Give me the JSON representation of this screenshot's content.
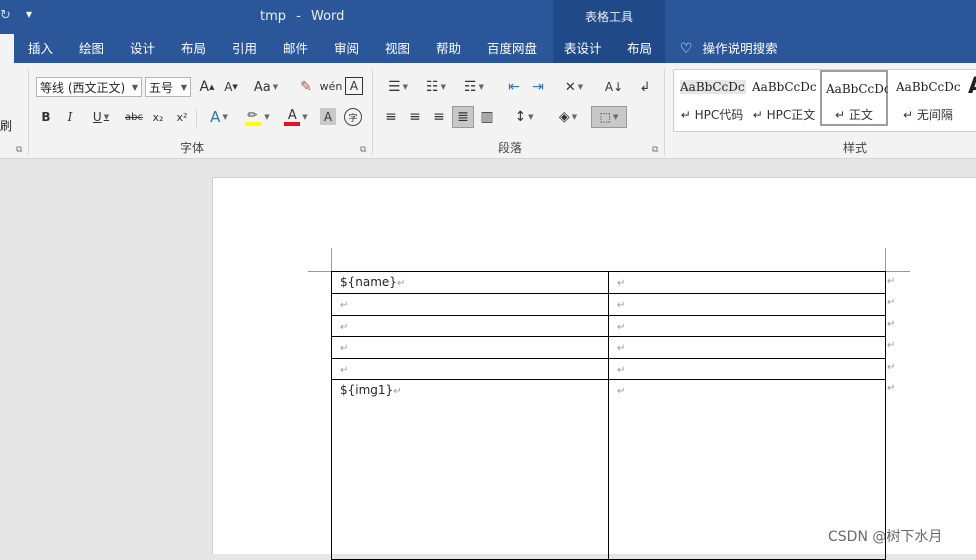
{
  "title_bar": {
    "doc_name": "tmp",
    "separator": "-",
    "app_name": "Word",
    "contextual_group": "表格工具"
  },
  "ribbon_tabs": [
    {
      "label": "插入"
    },
    {
      "label": "绘图"
    },
    {
      "label": "设计"
    },
    {
      "label": "布局"
    },
    {
      "label": "引用"
    },
    {
      "label": "邮件"
    },
    {
      "label": "审阅"
    },
    {
      "label": "视图"
    },
    {
      "label": "帮助"
    },
    {
      "label": "百度网盘"
    },
    {
      "label": "表设计"
    },
    {
      "label": "布局"
    }
  ],
  "tell_me": {
    "label": "操作说明搜索"
  },
  "clipboard": {
    "format_painter_fragment": "刷"
  },
  "font_group": {
    "label": "字体",
    "font_name": "等线 (西文正文)",
    "font_size": "五号",
    "grow": "A",
    "shrink": "A",
    "change_case": "Aa",
    "phonetic": "wén",
    "border_char": "A",
    "bold": "B",
    "italic": "I",
    "underline": "U",
    "strike": "abc",
    "subscript": "x₂",
    "superscript": "x²",
    "text_effect": "A",
    "font_color": "A",
    "char_shading": "A",
    "enclose": "字"
  },
  "paragraph_group": {
    "label": "段落"
  },
  "styles_group": {
    "label": "样式",
    "items": [
      {
        "sample": "AaBbCcDc",
        "name": "HPC代码"
      },
      {
        "sample": "AaBbCcDc",
        "name": "HPC正文"
      },
      {
        "sample": "AaBbCcDc",
        "name": "正文"
      },
      {
        "sample": "AaBbCcDc",
        "name": "无间隔"
      }
    ]
  },
  "document": {
    "rows": [
      [
        "${name}",
        ""
      ],
      [
        "",
        ""
      ],
      [
        "",
        ""
      ],
      [
        "",
        ""
      ],
      [
        "",
        ""
      ],
      [
        "${img1}",
        ""
      ]
    ],
    "paragraph_mark": "↵"
  },
  "watermark": "CSDN @树下水月",
  "colors": {
    "title_bar": "#2b579a",
    "contextual_tab": "#1f4a87",
    "ribbon_bg": "#f3f3f3",
    "font_color_bar": "#e81123",
    "highlight_bar": "#ffff00"
  }
}
